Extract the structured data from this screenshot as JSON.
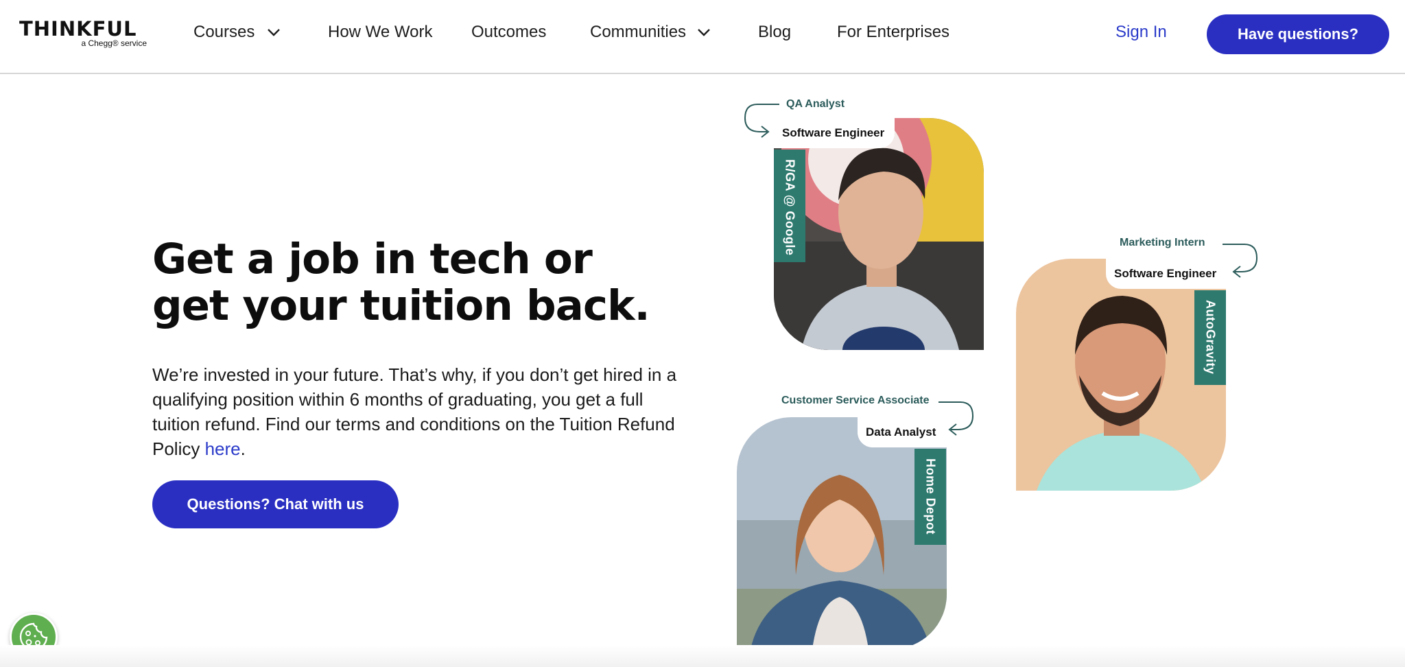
{
  "header": {
    "logo": {
      "word": "THINKFUL",
      "sub": "a Chegg® service"
    },
    "nav": [
      {
        "label": "Courses",
        "dropdown": true
      },
      {
        "label": "How We Work",
        "dropdown": false
      },
      {
        "label": "Outcomes",
        "dropdown": false
      },
      {
        "label": "Communities",
        "dropdown": true
      },
      {
        "label": "Blog",
        "dropdown": false
      },
      {
        "label": "For Enterprises",
        "dropdown": false
      }
    ],
    "sign_in": "Sign In",
    "cta": "Have questions?"
  },
  "hero": {
    "title": "Get a job in tech or get your tuition back.",
    "body": "We’re invested in your future. That’s why, if you don’t get hired in a qualifying position within 6 months of graduating, you get a full tuition refund. Find our terms and conditions on the Tuition Refund Policy ",
    "link": "here",
    "period": ".",
    "cta": "Questions? Chat with us"
  },
  "stories": [
    {
      "previous_role": "QA Analyst",
      "new_role": "Software Engineer",
      "company": "R/GA @ Google"
    },
    {
      "previous_role": "Marketing Intern",
      "new_role": "Software Engineer",
      "company": "AutoGravity"
    },
    {
      "previous_role": "Customer Service Associate",
      "new_role": "Data Analyst",
      "company": "Home Depot"
    }
  ],
  "colors": {
    "brand_blue": "#2a2fc2",
    "link_blue": "#2b3bc9",
    "teal": "#2e7a6f",
    "cookie_green": "#5fae4f"
  },
  "icons": {
    "chevron": "chevron-down-icon",
    "arrow": "curved-arrow-icon",
    "cookie": "cookie-icon"
  }
}
